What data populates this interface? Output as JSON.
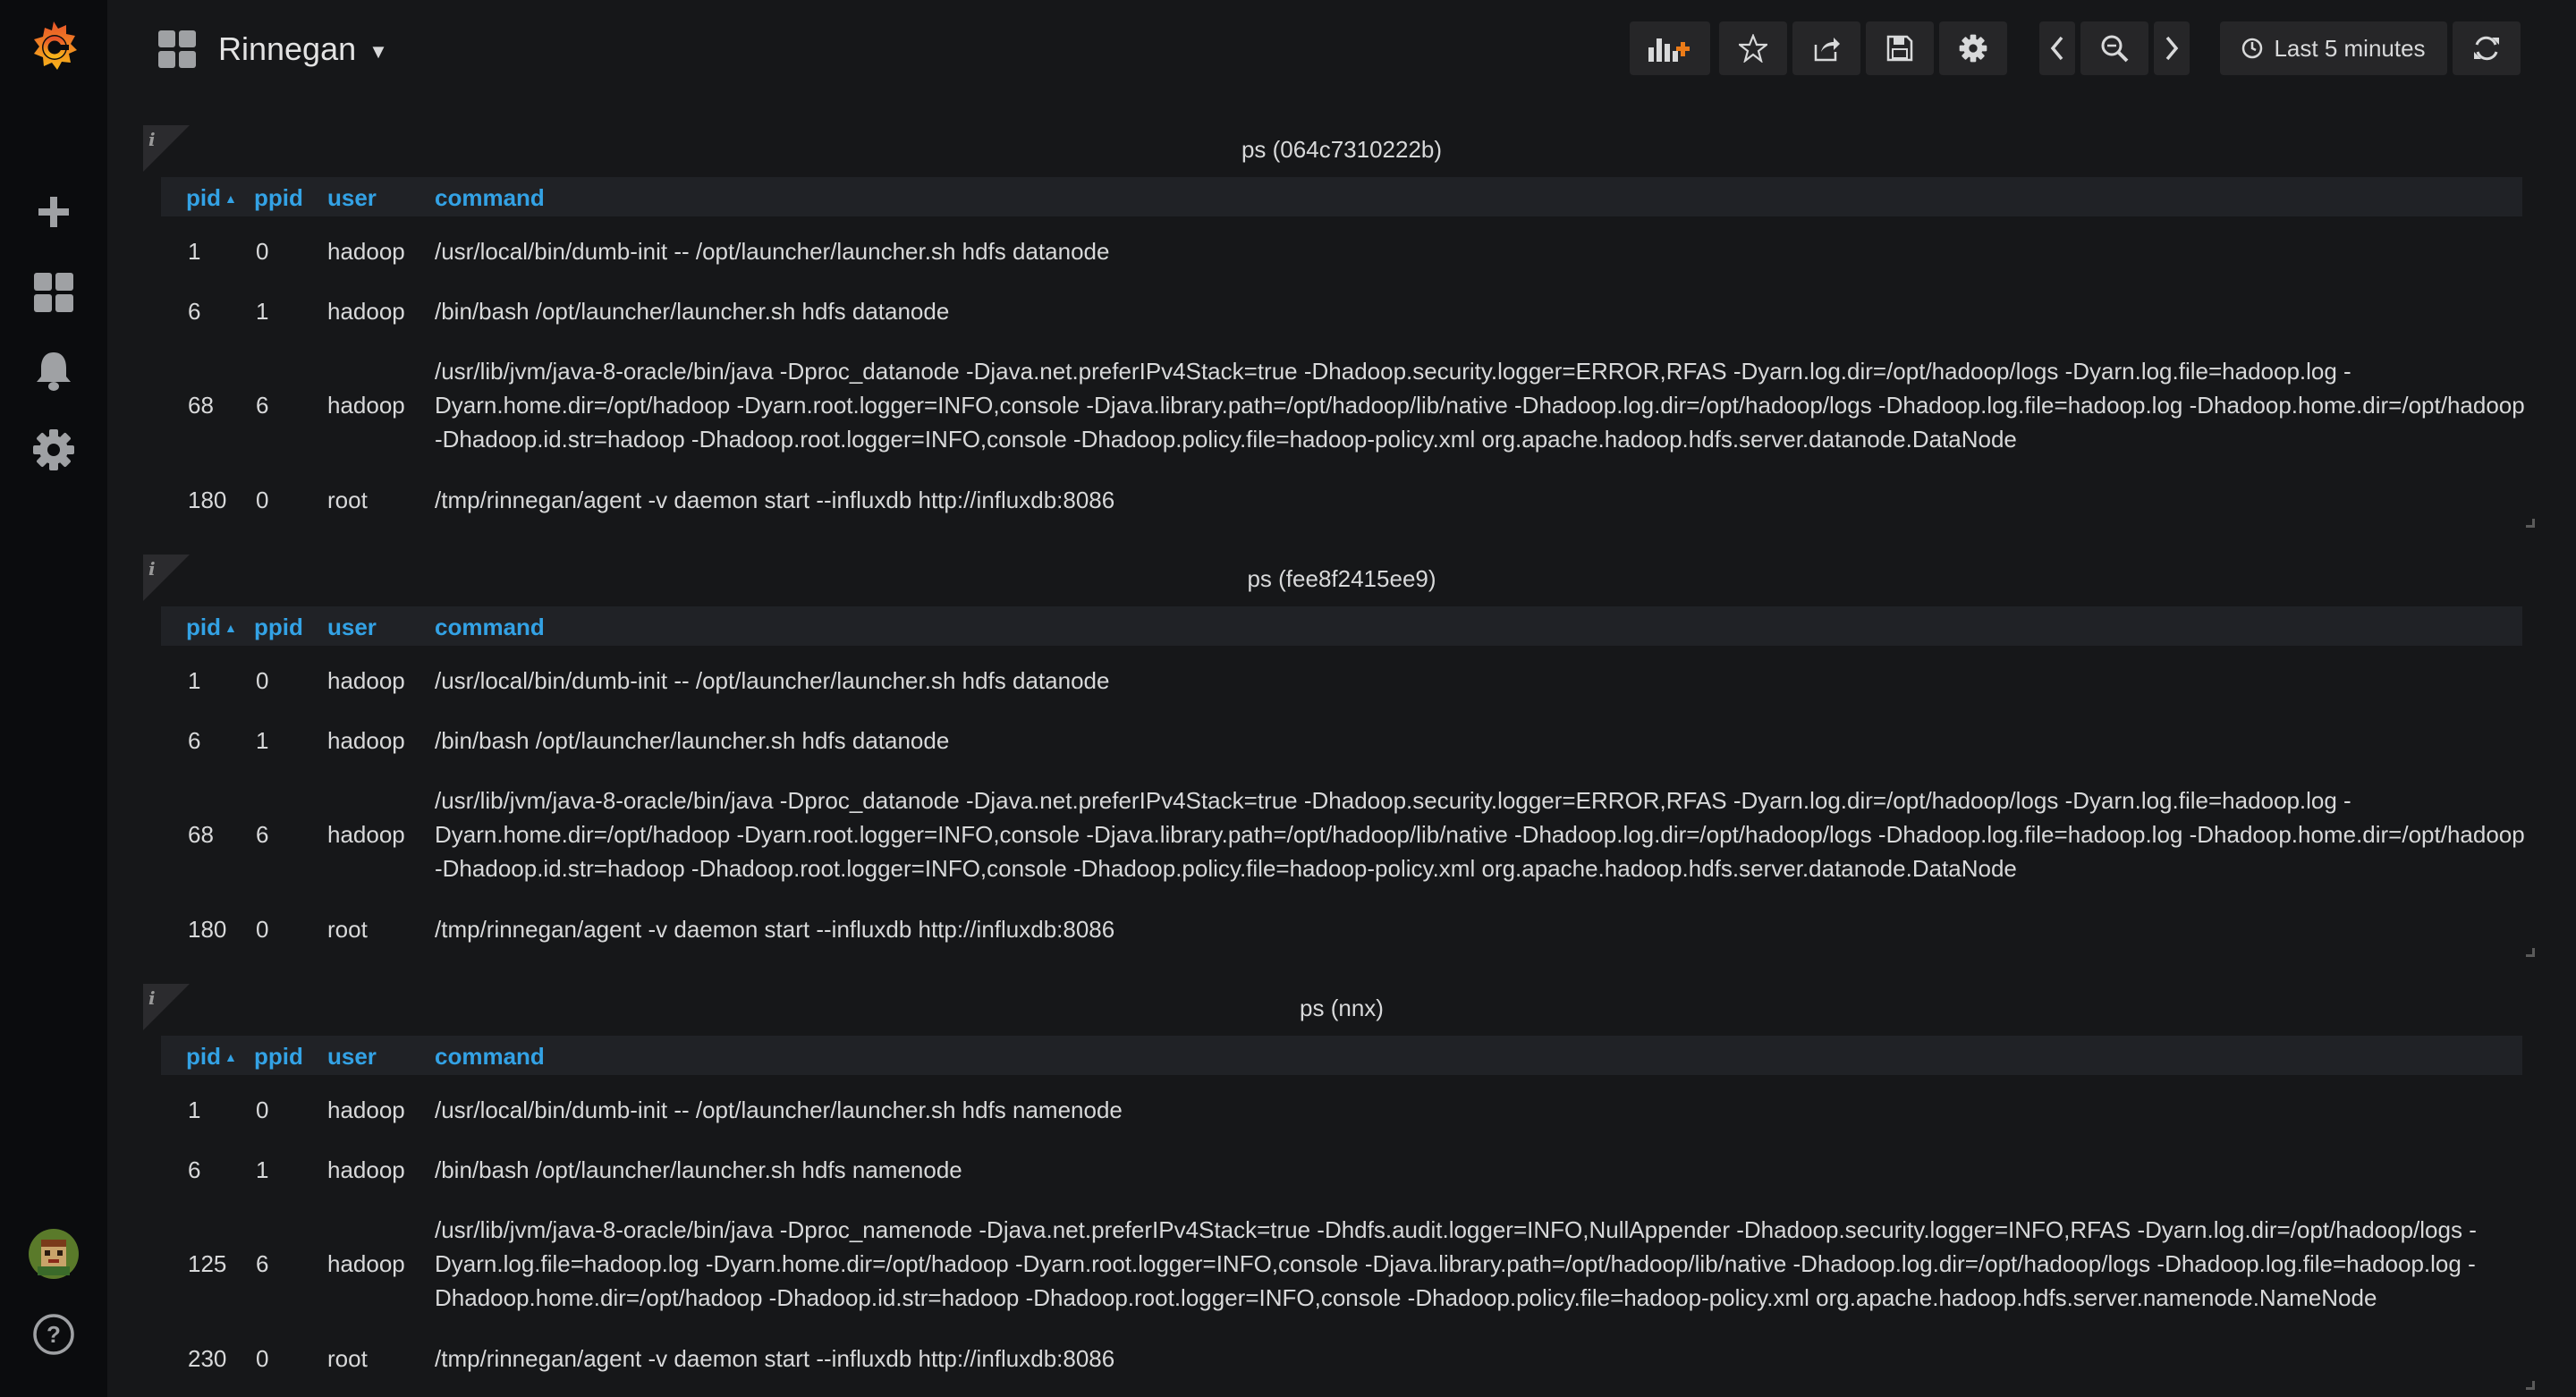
{
  "dashboard": {
    "title": "Rinnegan"
  },
  "toolbar": {
    "time_range": "Last 5 minutes"
  },
  "columns": {
    "pid": "pid",
    "ppid": "ppid",
    "user": "user",
    "command": "command"
  },
  "panels": [
    {
      "title": "ps (064c7310222b)",
      "rows": [
        {
          "pid": "1",
          "ppid": "0",
          "user": "hadoop",
          "command": "/usr/local/bin/dumb-init -- /opt/launcher/launcher.sh hdfs datanode"
        },
        {
          "pid": "6",
          "ppid": "1",
          "user": "hadoop",
          "command": "/bin/bash /opt/launcher/launcher.sh hdfs datanode"
        },
        {
          "pid": "68",
          "ppid": "6",
          "user": "hadoop",
          "command": "/usr/lib/jvm/java-8-oracle/bin/java -Dproc_datanode -Djava.net.preferIPv4Stack=true -Dhadoop.security.logger=ERROR,RFAS -Dyarn.log.dir=/opt/hadoop/logs -Dyarn.log.file=hadoop.log -Dyarn.home.dir=/opt/hadoop -Dyarn.root.logger=INFO,console -Djava.library.path=/opt/hadoop/lib/native -Dhadoop.log.dir=/opt/hadoop/logs -Dhadoop.log.file=hadoop.log -Dhadoop.home.dir=/opt/hadoop -Dhadoop.id.str=hadoop -Dhadoop.root.logger=INFO,console -Dhadoop.policy.file=hadoop-policy.xml org.apache.hadoop.hdfs.server.datanode.DataNode"
        },
        {
          "pid": "180",
          "ppid": "0",
          "user": "root",
          "command": "/tmp/rinnegan/agent -v daemon start --influxdb http://influxdb:8086"
        }
      ]
    },
    {
      "title": "ps (fee8f2415ee9)",
      "rows": [
        {
          "pid": "1",
          "ppid": "0",
          "user": "hadoop",
          "command": "/usr/local/bin/dumb-init -- /opt/launcher/launcher.sh hdfs datanode"
        },
        {
          "pid": "6",
          "ppid": "1",
          "user": "hadoop",
          "command": "/bin/bash /opt/launcher/launcher.sh hdfs datanode"
        },
        {
          "pid": "68",
          "ppid": "6",
          "user": "hadoop",
          "command": "/usr/lib/jvm/java-8-oracle/bin/java -Dproc_datanode -Djava.net.preferIPv4Stack=true -Dhadoop.security.logger=ERROR,RFAS -Dyarn.log.dir=/opt/hadoop/logs -Dyarn.log.file=hadoop.log -Dyarn.home.dir=/opt/hadoop -Dyarn.root.logger=INFO,console -Djava.library.path=/opt/hadoop/lib/native -Dhadoop.log.dir=/opt/hadoop/logs -Dhadoop.log.file=hadoop.log -Dhadoop.home.dir=/opt/hadoop -Dhadoop.id.str=hadoop -Dhadoop.root.logger=INFO,console -Dhadoop.policy.file=hadoop-policy.xml org.apache.hadoop.hdfs.server.datanode.DataNode"
        },
        {
          "pid": "180",
          "ppid": "0",
          "user": "root",
          "command": "/tmp/rinnegan/agent -v daemon start --influxdb http://influxdb:8086"
        }
      ]
    },
    {
      "title": "ps (nnx)",
      "rows": [
        {
          "pid": "1",
          "ppid": "0",
          "user": "hadoop",
          "command": "/usr/local/bin/dumb-init -- /opt/launcher/launcher.sh hdfs namenode"
        },
        {
          "pid": "6",
          "ppid": "1",
          "user": "hadoop",
          "command": "/bin/bash /opt/launcher/launcher.sh hdfs namenode"
        },
        {
          "pid": "125",
          "ppid": "6",
          "user": "hadoop",
          "command": "/usr/lib/jvm/java-8-oracle/bin/java -Dproc_namenode -Djava.net.preferIPv4Stack=true -Dhdfs.audit.logger=INFO,NullAppender -Dhadoop.security.logger=INFO,RFAS -Dyarn.log.dir=/opt/hadoop/logs -Dyarn.log.file=hadoop.log -Dyarn.home.dir=/opt/hadoop -Dyarn.root.logger=INFO,console -Djava.library.path=/opt/hadoop/lib/native -Dhadoop.log.dir=/opt/hadoop/logs -Dhadoop.log.file=hadoop.log -Dhadoop.home.dir=/opt/hadoop -Dhadoop.id.str=hadoop -Dhadoop.root.logger=INFO,console -Dhadoop.policy.file=hadoop-policy.xml org.apache.hadoop.hdfs.server.namenode.NameNode"
        },
        {
          "pid": "230",
          "ppid": "0",
          "user": "root",
          "command": "/tmp/rinnegan/agent -v daemon start --influxdb http://influxdb:8086"
        }
      ]
    }
  ]
}
